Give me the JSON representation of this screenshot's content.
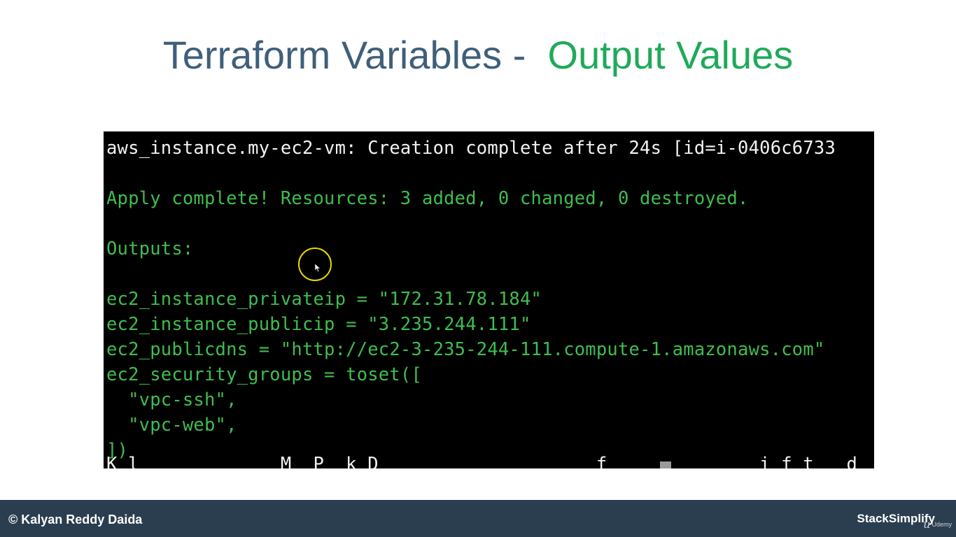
{
  "slide": {
    "title_main": "Terraform Variables -  ",
    "title_accent": "Output Values",
    "colors": {
      "title_main": "#3f5f7a",
      "title_accent": "#1faa59",
      "terminal_bg": "#000000",
      "terminal_green": "#3fbd4f",
      "footer_bg": "#2b3e50"
    }
  },
  "terminal": {
    "lines": [
      {
        "text": "aws_instance.my-ec2-vm: Creation complete after 24s [id=i-0406c6733",
        "color": "white"
      },
      {
        "text": "",
        "color": "white"
      },
      {
        "text": "Apply complete! Resources: 3 added, 0 changed, 0 destroyed.",
        "color": "green"
      },
      {
        "text": "",
        "color": "green"
      },
      {
        "text": "Outputs:",
        "color": "green"
      },
      {
        "text": "",
        "color": "green"
      },
      {
        "text": "ec2_instance_privateip = \"172.31.78.184\"",
        "color": "green"
      },
      {
        "text": "ec2_instance_publicip = \"3.235.244.111\"",
        "color": "green"
      },
      {
        "text": "ec2_publicdns = \"http://ec2-3-235-244-111.compute-1.amazonaws.com\"",
        "color": "green"
      },
      {
        "text": "ec2_security_groups = toset([",
        "color": "green"
      },
      {
        "text": "  \"vpc-ssh\",",
        "color": "green"
      },
      {
        "text": "  \"vpc-web\",",
        "color": "green"
      },
      {
        "text": "])",
        "color": "green"
      }
    ],
    "top_cut_line": "                          ",
    "bottom_cut_line": "K l             M  P  k D                    f              i f t   d  b i t $",
    "cursor_icon": "mouse-pointer-icon"
  },
  "footer": {
    "copyright": "© Kalyan Reddy Daida",
    "brand": "StackSimplify",
    "udemy_logo": "Udemy"
  }
}
